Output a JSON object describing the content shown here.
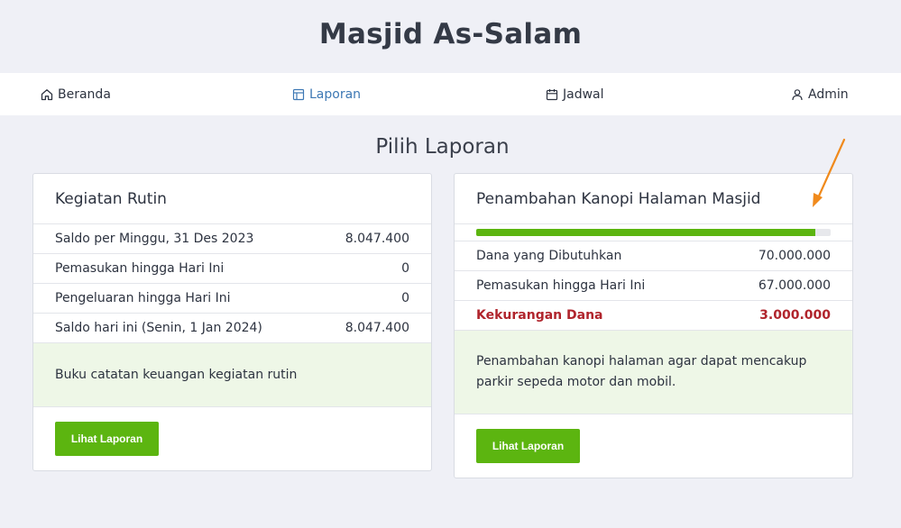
{
  "site": {
    "title": "Masjid As-Salam"
  },
  "nav": {
    "items": [
      {
        "label": "Beranda",
        "icon": "home-icon"
      },
      {
        "label": "Laporan",
        "icon": "layout-icon",
        "active": true
      },
      {
        "label": "Jadwal",
        "icon": "calendar-icon"
      },
      {
        "label": "Admin",
        "icon": "user-icon"
      }
    ]
  },
  "page": {
    "heading": "Pilih Laporan"
  },
  "cards": [
    {
      "title": "Kegiatan Rutin",
      "rows": [
        {
          "label": "Saldo per Minggu, 31 Des 2023",
          "value": "8.047.400"
        },
        {
          "label": "Pemasukan hingga Hari Ini",
          "value": "0"
        },
        {
          "label": "Pengeluaran hingga Hari Ini",
          "value": "0"
        },
        {
          "label": "Saldo hari ini (Senin, 1 Jan 2024)",
          "value": "8.047.400"
        }
      ],
      "description": "Buku catatan keuangan kegiatan rutin",
      "button_label": "Lihat Laporan"
    },
    {
      "title": "Penambahan Kanopi Halaman Masjid",
      "progress_percent": 95.7,
      "rows": [
        {
          "label": "Dana yang Dibutuhkan",
          "value": "70.000.000"
        },
        {
          "label": "Pemasukan hingga Hari Ini",
          "value": "67.000.000"
        },
        {
          "label": "Kekurangan Dana",
          "value": "3.000.000"
        }
      ],
      "description": "Penambahan kanopi halaman agar dapat mencakup parkir sepeda motor dan mobil.",
      "button_label": "Lihat Laporan"
    }
  ],
  "colors": {
    "accent_green": "#5cb510",
    "active_link": "#3d78b4",
    "shortage_red": "#b0242c",
    "annotation_arrow": "#f08a1c"
  }
}
